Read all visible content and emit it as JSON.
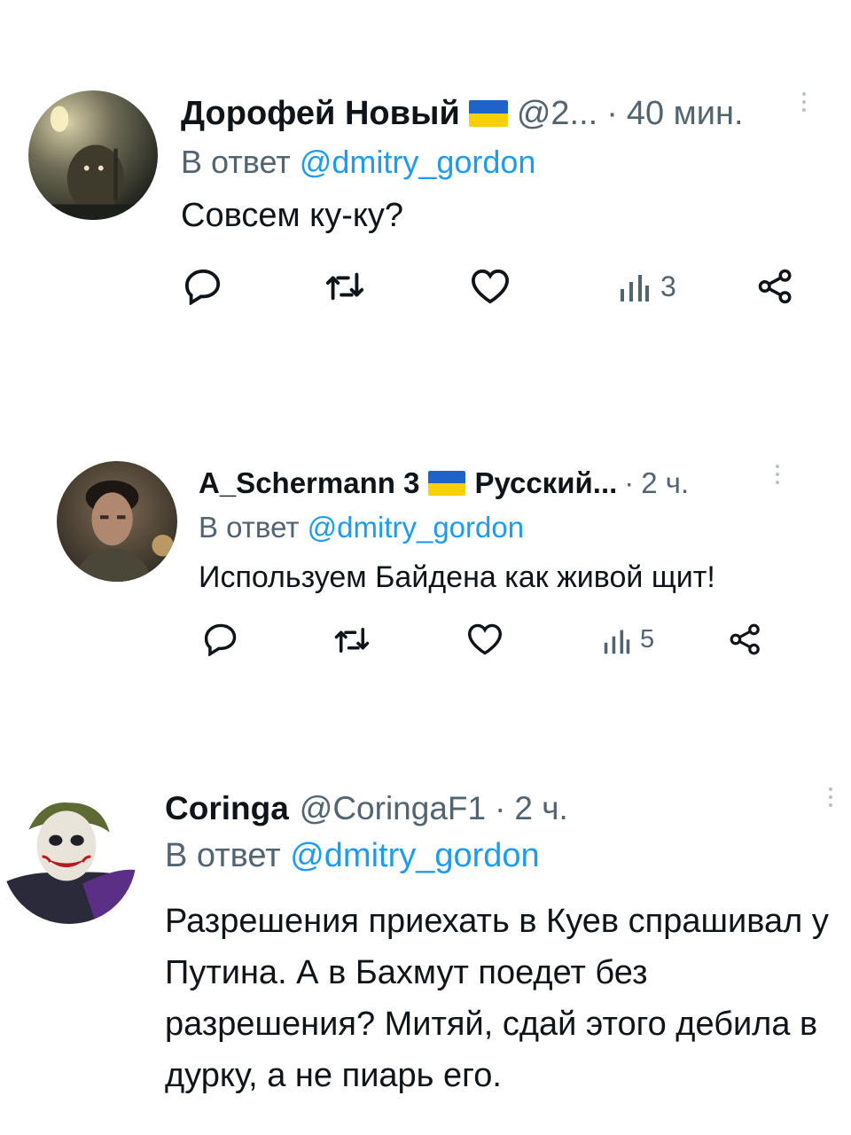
{
  "tweets": [
    {
      "author": "Дорофей Новый",
      "handle": "@2...",
      "separator": "·",
      "time": "40 мин.",
      "reply_prefix": "В ответ",
      "reply_mention": "@dmitry_gordon",
      "text": "Совсем ку-ку?",
      "views": "3",
      "flag_icon": "ukraine-flag-icon",
      "avatar_icon": "hedgehog-avatar"
    },
    {
      "author": "A_Schermann 3",
      "handle": "Русский...",
      "separator": "·",
      "time": "2 ч.",
      "reply_prefix": "В ответ",
      "reply_mention": "@dmitry_gordon",
      "text": "Используем Байдена как живой щит!",
      "views": "5",
      "flag_icon": "ukraine-flag-icon",
      "avatar_icon": "man-portrait-avatar"
    },
    {
      "author": "Coringa",
      "handle": "@CoringaF1",
      "separator": "·",
      "time": "2 ч.",
      "reply_prefix": "В ответ",
      "reply_mention": "@dmitry_gordon",
      "text": "Разрешения приехать в Куев спрашивал у Путина. А в Бахмут поедет без разрешения? Митяй, сдай этого дебила в дурку, а не пиарь его.",
      "avatar_icon": "joker-avatar"
    }
  ],
  "colors": {
    "text": "#0f1419",
    "secondary": "#536471",
    "link": "#1d9bf0",
    "flag_blue": "#1e63c7",
    "flag_yellow": "#f6d000"
  }
}
